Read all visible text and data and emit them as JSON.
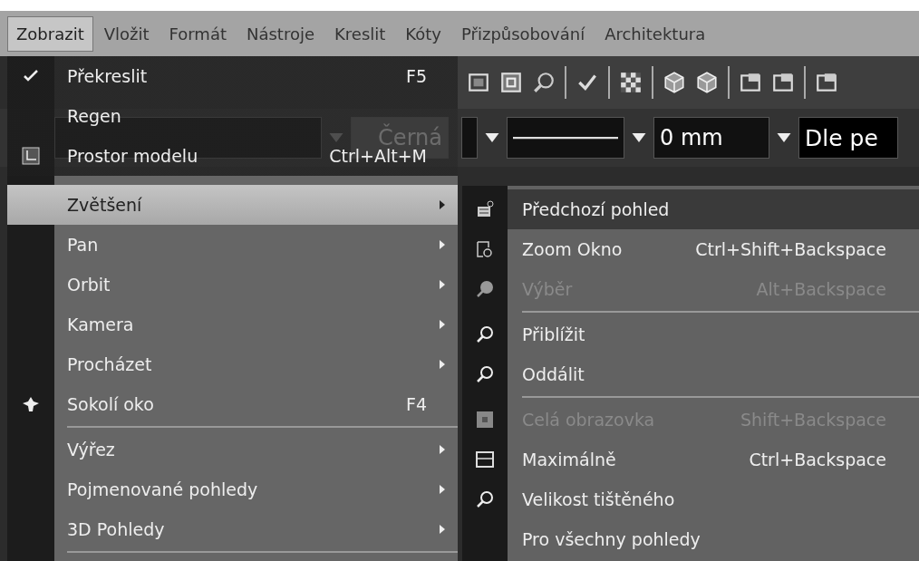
{
  "menubar": [
    {
      "label": "Zobrazit",
      "selected": true
    },
    {
      "label": "Vložit",
      "selected": false
    },
    {
      "label": "Formát",
      "selected": false
    },
    {
      "label": "Nástroje",
      "selected": false
    },
    {
      "label": "Kreslit",
      "selected": false
    },
    {
      "label": "Kóty",
      "selected": false
    },
    {
      "label": "Přizpůsobování",
      "selected": false
    },
    {
      "label": "Architektura",
      "selected": false
    }
  ],
  "property_bar": {
    "color_name": "Černá",
    "lineweight": "0 mm",
    "plot_style": "Dle pe"
  },
  "menu": {
    "items": [
      {
        "kind": "item",
        "label": "Překreslit",
        "shortcut": "F5",
        "submenu": false,
        "selected": false
      },
      {
        "kind": "item",
        "label": "Regen",
        "submenu": false,
        "selected": false
      },
      {
        "kind": "item",
        "label": "Prostor modelu",
        "shortcut": "Ctrl+Alt+M",
        "submenu": false,
        "selected": false
      },
      {
        "kind": "item",
        "label": "Zvětšení",
        "submenu": true,
        "selected": true
      },
      {
        "kind": "item",
        "label": "Pan",
        "submenu": true,
        "selected": false
      },
      {
        "kind": "item",
        "label": "Orbit",
        "submenu": true,
        "selected": false
      },
      {
        "kind": "item",
        "label": "Kamera",
        "submenu": true,
        "selected": false
      },
      {
        "kind": "item",
        "label": "Procházet",
        "submenu": true,
        "selected": false
      },
      {
        "kind": "item",
        "label": "Sokolí oko",
        "shortcut": "F4",
        "submenu": false,
        "selected": false
      },
      {
        "kind": "separator"
      },
      {
        "kind": "item",
        "label": "Výřez",
        "submenu": true,
        "selected": false
      },
      {
        "kind": "item",
        "label": "Pojmenované pohledy",
        "submenu": true,
        "selected": false
      },
      {
        "kind": "item",
        "label": "3D Pohledy",
        "submenu": true,
        "selected": false
      },
      {
        "kind": "separator"
      }
    ]
  },
  "submenu": {
    "items": [
      {
        "kind": "item",
        "label": "Předchozí pohled",
        "disabled": false,
        "selected": true
      },
      {
        "kind": "item",
        "label": "Zoom Okno",
        "shortcut": "Ctrl+Shift+Backspace",
        "disabled": false,
        "selected": false
      },
      {
        "kind": "item",
        "label": "Výběr",
        "shortcut": "Alt+Backspace",
        "disabled": true,
        "selected": false
      },
      {
        "kind": "separator"
      },
      {
        "kind": "item",
        "label": "Přiblížit",
        "disabled": false,
        "selected": false
      },
      {
        "kind": "item",
        "label": "Oddálit",
        "disabled": false,
        "selected": false
      },
      {
        "kind": "separator"
      },
      {
        "kind": "item",
        "label": "Celá obrazovka",
        "shortcut": "Shift+Backspace",
        "disabled": true,
        "selected": false
      },
      {
        "kind": "item",
        "label": "Maximálně",
        "shortcut": "Ctrl+Backspace",
        "disabled": false,
        "selected": false
      },
      {
        "kind": "item",
        "label": "Velikost tištěného",
        "disabled": false,
        "selected": false
      },
      {
        "kind": "item",
        "label": "Pro všechny pohledy",
        "disabled": false,
        "selected": false
      }
    ]
  }
}
